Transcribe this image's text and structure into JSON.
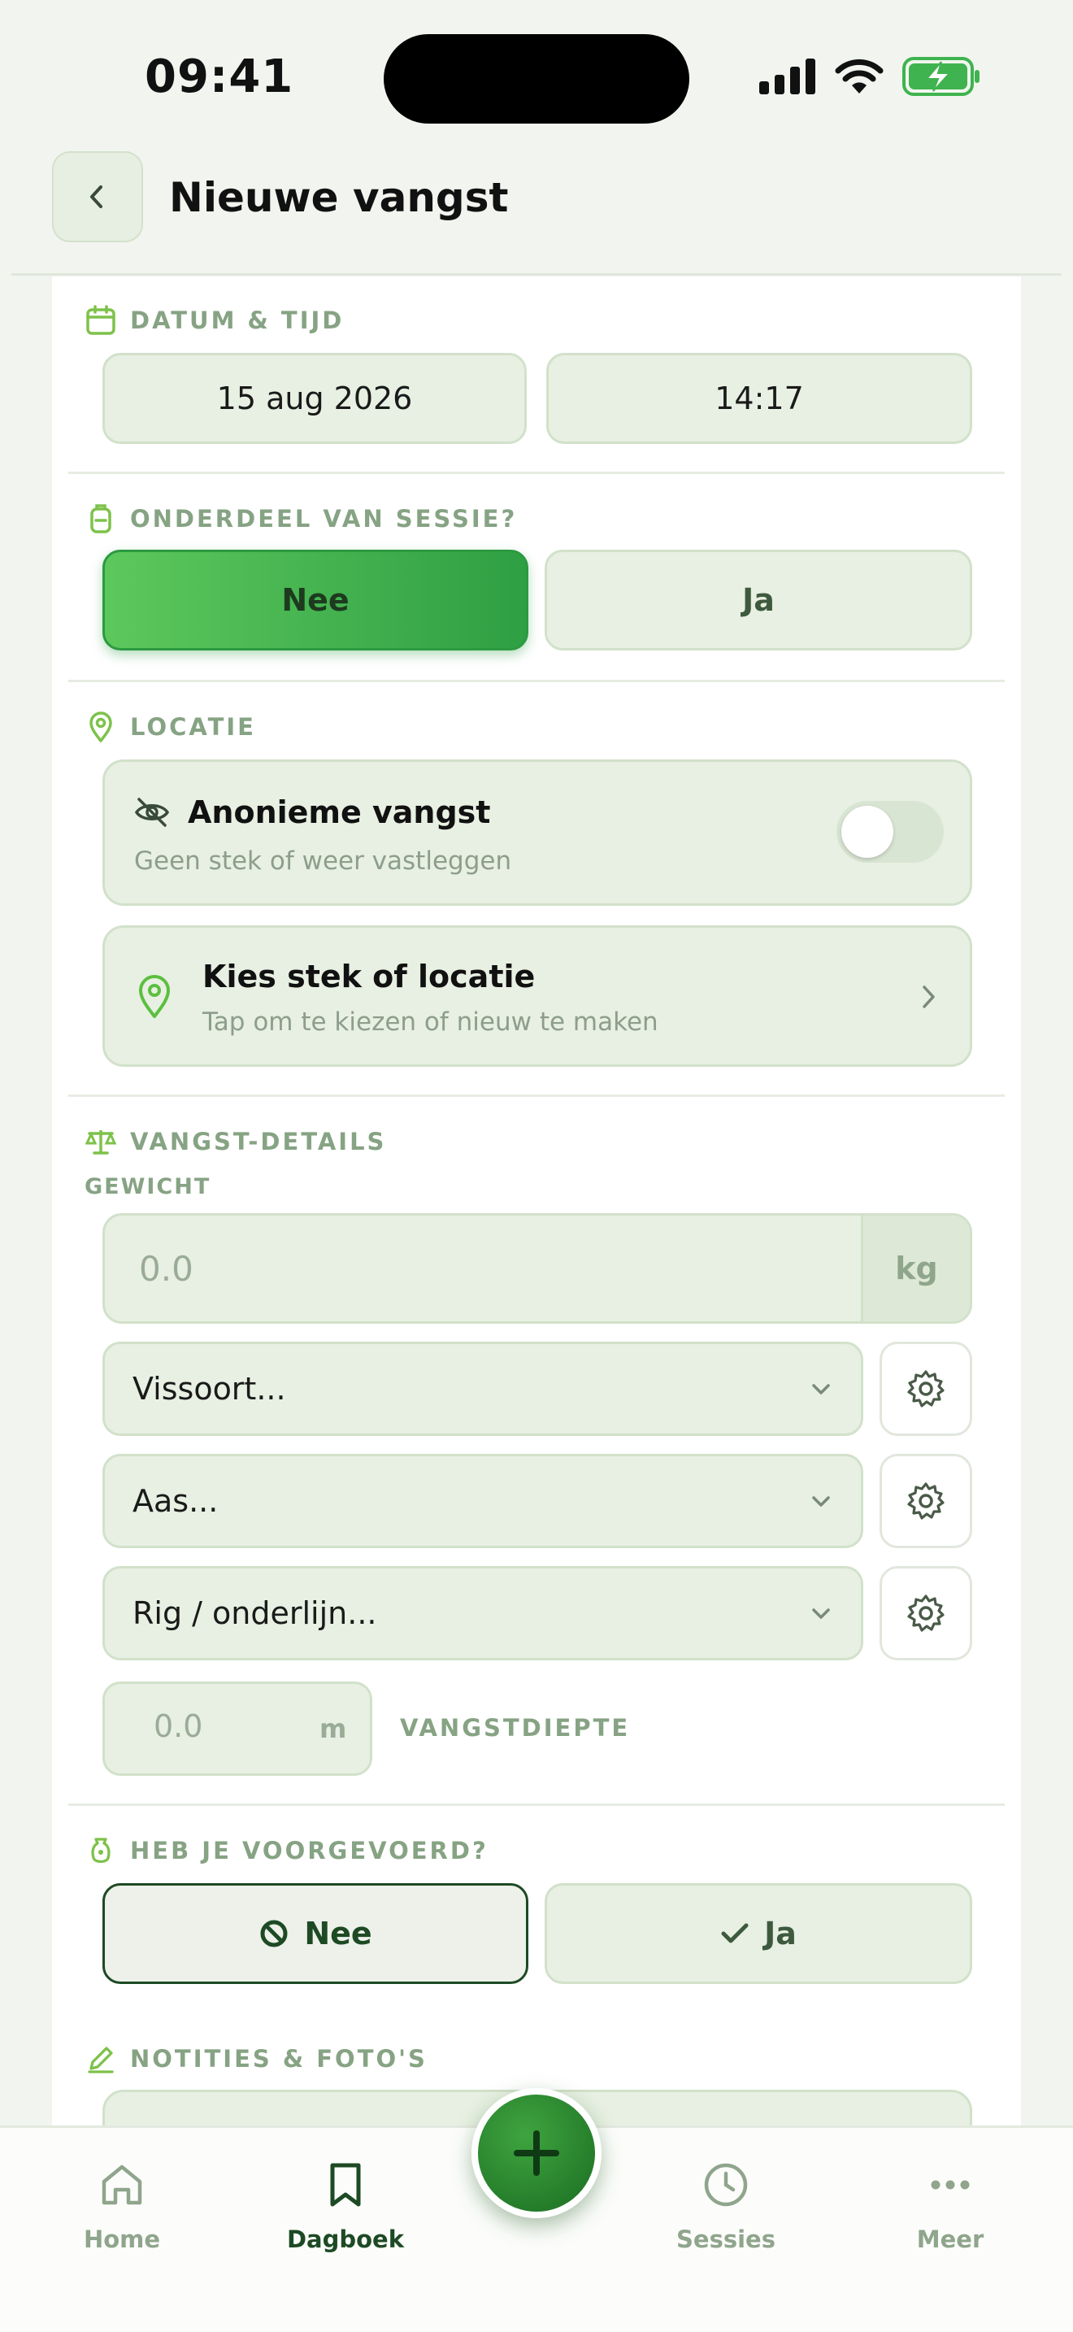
{
  "status_bar": {
    "time": "09:41"
  },
  "header": {
    "title": "Nieuwe vangst"
  },
  "datum_tijd": {
    "label": "DATUM & TIJD",
    "date": "15 aug 2026",
    "time": "14:17"
  },
  "sessie": {
    "label": "ONDERDEEL VAN SESSIE?",
    "options": [
      "Nee",
      "Ja"
    ],
    "selected": "Nee"
  },
  "locatie": {
    "label": "LOCATIE",
    "anonymous": {
      "title": "Anonieme vangst",
      "subtitle": "Geen stek of weer vastleggen",
      "enabled": false
    },
    "pick": {
      "title": "Kies stek of locatie",
      "subtitle": "Tap om te kiezen of nieuw te maken"
    }
  },
  "details": {
    "label": "VANGST-DETAILS",
    "weight_label": "GEWICHT",
    "weight_placeholder": "0.0",
    "weight_unit": "kg",
    "species_placeholder": "Vissoort...",
    "bait_placeholder": "Aas...",
    "rig_placeholder": "Rig / onderlijn...",
    "depth_placeholder": "0.0",
    "depth_unit": "m",
    "depth_label": "VANGSTDIEPTE"
  },
  "voorgevoerd": {
    "label": "HEB JE VOORGEVOERD?",
    "no": "Nee",
    "yes": "Ja",
    "selected": "Nee"
  },
  "notities": {
    "label": "NOTITIES & FOTO'S"
  },
  "nav": {
    "items": [
      {
        "label": "Home",
        "icon": "home-icon"
      },
      {
        "label": "Dagboek",
        "icon": "bookmark-icon",
        "active": true
      },
      {
        "label": "Sessies",
        "icon": "clock-icon"
      },
      {
        "label": "Meer",
        "icon": "more-icon"
      }
    ],
    "fab_icon": "plus-icon"
  },
  "colors": {
    "accent": "#2f9f44",
    "dark_green": "#1d4a24",
    "label_green": "#86a383",
    "field_bg": "#e7f0e2"
  }
}
